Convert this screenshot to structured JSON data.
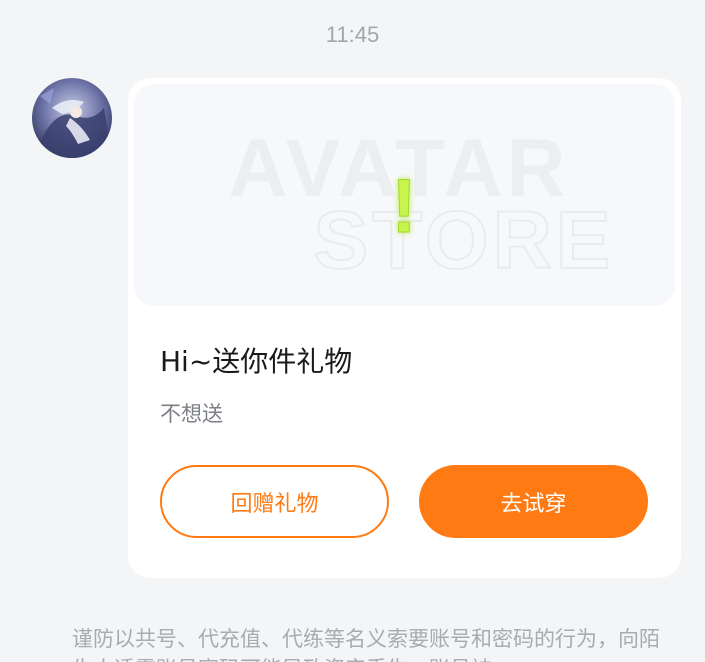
{
  "timestamp": "11:45",
  "card": {
    "banner_watermark_line1": "AVATAR",
    "banner_watermark_line2": "STORE",
    "banner_glyph": "!",
    "title": "Hi~送你件礼物",
    "subtitle": "不想送",
    "buttons": {
      "return_gift": "回赠礼物",
      "try_on": "去试穿"
    }
  },
  "notice": "谨防以共号、代充值、代练等名义索要账号和密码的行为，向陌生人透露账号密码可能导致资产丢失、账号被",
  "colors": {
    "accent": "#ff7a13",
    "background": "#f4f5f7",
    "glyph_green": "#c8f54e"
  }
}
